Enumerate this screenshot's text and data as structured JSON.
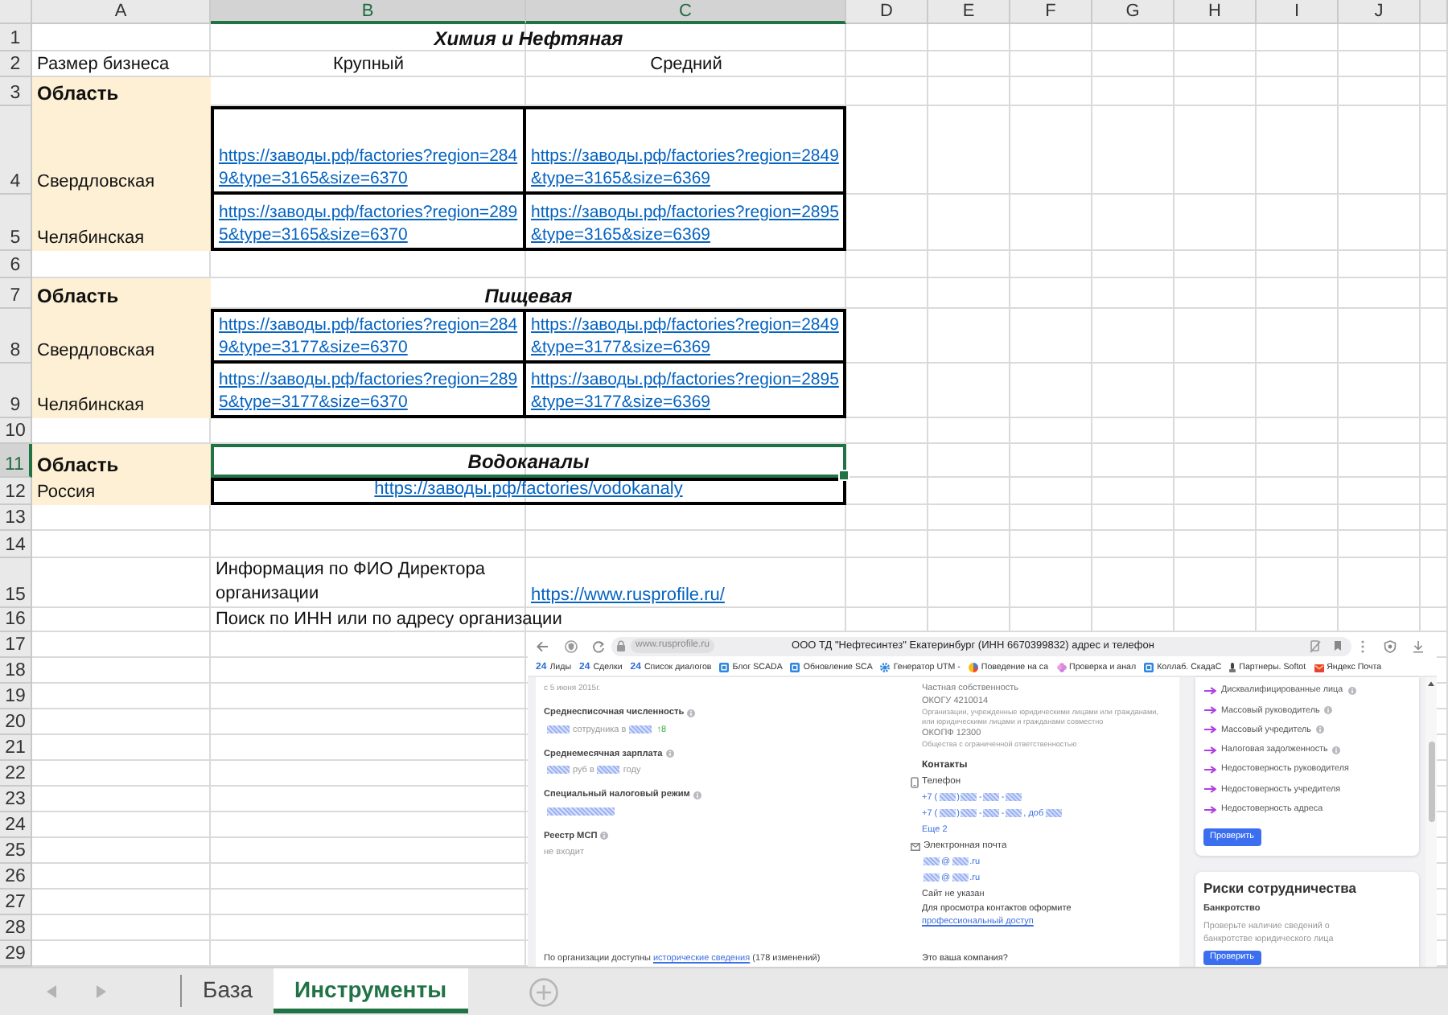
{
  "sheet": {
    "columns": [
      {
        "label": "A",
        "selected": false
      },
      {
        "label": "B",
        "selected": true
      },
      {
        "label": "C",
        "selected": true
      },
      {
        "label": "D",
        "selected": false
      },
      {
        "label": "E",
        "selected": false
      },
      {
        "label": "F",
        "selected": false
      },
      {
        "label": "G",
        "selected": false
      },
      {
        "label": "H",
        "selected": false
      },
      {
        "label": "I",
        "selected": false
      },
      {
        "label": "J",
        "selected": false
      }
    ],
    "rows": [
      {
        "number": "1",
        "kind": "title",
        "selected": false,
        "highlighted": false,
        "title": "Химия и Нефтяная"
      },
      {
        "number": "2",
        "kind": "headers",
        "selected": false,
        "highlighted": false,
        "label": "Размер бизнеса",
        "headers": [
          "Крупный",
          "Средний"
        ]
      },
      {
        "number": "3",
        "kind": "section",
        "selected": false,
        "highlighted": true,
        "label": "Область"
      },
      {
        "number": "4",
        "kind": "links",
        "selected": false,
        "highlighted": true,
        "label": "Свердловская",
        "links": [
          "https://заводы.рф/factories?region=2849&type=3165&size=6370",
          "https://заводы.рф/factories?region=2849&type=3165&size=6369"
        ]
      },
      {
        "number": "5",
        "kind": "links",
        "selected": false,
        "highlighted": true,
        "label": "Челябинская",
        "links": [
          "https://заводы.рф/factories?region=2895&type=3165&size=6370",
          "https://заводы.рф/factories?region=2895&type=3165&size=6369"
        ]
      },
      {
        "number": "6",
        "kind": "blank",
        "selected": false,
        "highlighted": false
      },
      {
        "number": "7",
        "kind": "section",
        "selected": false,
        "highlighted": true,
        "label": "Область",
        "title": "Пищевая"
      },
      {
        "number": "8",
        "kind": "links",
        "selected": false,
        "highlighted": true,
        "label": "Свердловская",
        "links": [
          "https://заводы.рф/factories?region=2849&type=3177&size=6370",
          "https://заводы.рф/factories?region=2849&type=3177&size=6369"
        ]
      },
      {
        "number": "9",
        "kind": "links",
        "selected": false,
        "highlighted": true,
        "label": "Челябинская",
        "links": [
          "https://заводы.рф/factories?region=2895&type=3177&size=6370",
          "https://заводы.рф/factories?region=2895&type=3177&size=6369"
        ]
      },
      {
        "number": "10",
        "kind": "blank",
        "selected": false,
        "highlighted": false
      },
      {
        "number": "11",
        "kind": "section",
        "selected": true,
        "highlighted": true,
        "label": "Область",
        "title": "Водоканалы"
      },
      {
        "number": "12",
        "kind": "wide_link",
        "selected": false,
        "highlighted": true,
        "label": "Россия",
        "link": "https://заводы.рф/factories/vodokanaly"
      },
      {
        "number": "13",
        "kind": "blank",
        "selected": false,
        "highlighted": false
      },
      {
        "number": "14",
        "kind": "blank",
        "selected": false,
        "highlighted": false
      },
      {
        "number": "15",
        "kind": "info",
        "selected": false,
        "highlighted": false,
        "text": "Информация по ФИО Директора организации",
        "link": "https://www.rusprofile.ru/"
      },
      {
        "number": "16",
        "kind": "info",
        "selected": false,
        "highlighted": false,
        "text": "Поиск по ИНН или по адресу организации"
      },
      {
        "number": "17",
        "kind": "blank",
        "selected": false,
        "highlighted": false
      },
      {
        "number": "18",
        "kind": "blank",
        "selected": false,
        "highlighted": false
      },
      {
        "number": "19",
        "kind": "blank",
        "selected": false,
        "highlighted": false
      },
      {
        "number": "20",
        "kind": "blank",
        "selected": false,
        "highlighted": false
      },
      {
        "number": "21",
        "kind": "blank",
        "selected": false,
        "highlighted": false
      },
      {
        "number": "22",
        "kind": "blank",
        "selected": false,
        "highlighted": false
      },
      {
        "number": "23",
        "kind": "blank",
        "selected": false,
        "highlighted": false
      },
      {
        "number": "24",
        "kind": "blank",
        "selected": false,
        "highlighted": false
      },
      {
        "number": "25",
        "kind": "blank",
        "selected": false,
        "highlighted": false
      },
      {
        "number": "26",
        "kind": "blank",
        "selected": false,
        "highlighted": false
      },
      {
        "number": "27",
        "kind": "blank",
        "selected": false,
        "highlighted": false
      },
      {
        "number": "28",
        "kind": "blank",
        "selected": false,
        "highlighted": false
      },
      {
        "number": "29",
        "kind": "blank",
        "selected": false,
        "highlighted": false
      }
    ]
  },
  "picture": {
    "address_bar": {
      "url": "www.rusprofile.ru",
      "title": "ООО ТД \"Нефтесинтез\" Екатеринбург (ИНН 6670399832) адрес и телефон"
    },
    "bookmarks": [
      {
        "kind": "logo",
        "logo": "24",
        "label": "Лиды"
      },
      {
        "kind": "logo",
        "logo": "24",
        "label": "Сделки"
      },
      {
        "kind": "logo",
        "logo": "24",
        "label": "Список диалогов"
      },
      {
        "kind": "tile",
        "label": "Блог SCADA"
      },
      {
        "kind": "tile",
        "label": "Обновление SCA"
      },
      {
        "kind": "gear",
        "label": "Генератор UTM -"
      },
      {
        "kind": "pie",
        "label": "Поведение на са"
      },
      {
        "kind": "flower",
        "label": "Проверка и анал"
      },
      {
        "kind": "tile",
        "label": "Коллаб. СкадаС"
      },
      {
        "kind": "pin",
        "label": "Партнеры. Softot"
      },
      {
        "kind": "envelope",
        "label": "Яндекс Почта"
      }
    ],
    "overview": [
      {
        "kind": "note",
        "text": "с 5 июня 2015г."
      },
      {
        "kind": "heading",
        "text": "Среднесписочная численность",
        "info": true
      },
      {
        "kind": "value",
        "parts": [
          {
            "kind": "redaction"
          },
          {
            "kind": "text",
            "text": "сотрудника в"
          },
          {
            "kind": "redaction"
          },
          {
            "kind": "accent",
            "text": "↑8"
          }
        ]
      },
      {
        "kind": "heading",
        "text": "Среднемесячная зарплата",
        "info": true
      },
      {
        "kind": "value",
        "parts": [
          {
            "kind": "redaction"
          },
          {
            "kind": "text",
            "text": "руб в"
          },
          {
            "kind": "redaction"
          },
          {
            "kind": "text",
            "text": "году"
          }
        ]
      },
      {
        "kind": "heading",
        "text": "Специальный налоговый режим",
        "info": true
      },
      {
        "kind": "value",
        "parts": [
          {
            "kind": "redaction"
          }
        ]
      },
      {
        "kind": "heading",
        "text": "Реестр МСП",
        "info": true
      },
      {
        "kind": "value",
        "parts": [
          {
            "kind": "text",
            "text": "не входит"
          }
        ]
      }
    ],
    "history": {
      "text": "По организации доступны",
      "link": "исторические сведения",
      "after": "(178 изменений)"
    },
    "registry": [
      {
        "kind": "code",
        "text": "Частная собственность"
      },
      {
        "kind": "code",
        "text": "ОКОГУ  4210014"
      },
      {
        "kind": "small",
        "text": "Организации, учрежденные юридическими лицами или гражданами, или юридическими лицами и гражданами совместно"
      },
      {
        "kind": "code",
        "text": "ОКОПФ  12300"
      },
      {
        "kind": "small",
        "text": "Общества с ограниченной ответственностью"
      }
    ],
    "contacts": {
      "title": "Контакты",
      "groups": [
        {
          "kind": "phone",
          "label": "Телефон",
          "lines": [
            {
              "parts": [
                {
                  "kind": "text",
                  "text": "+7 ("
                },
                {
                  "kind": "redaction"
                },
                {
                  "kind": "text",
                  "text": ")"
                },
                {
                  "kind": "redaction"
                },
                {
                  "kind": "text",
                  "text": "-"
                },
                {
                  "kind": "redaction"
                },
                {
                  "kind": "text",
                  "text": "-"
                },
                {
                  "kind": "redaction"
                }
              ]
            },
            {
              "parts": [
                {
                  "kind": "text",
                  "text": "+7 ("
                },
                {
                  "kind": "redaction"
                },
                {
                  "kind": "text",
                  "text": ")"
                },
                {
                  "kind": "redaction"
                },
                {
                  "kind": "text",
                  "text": "-"
                },
                {
                  "kind": "redaction"
                },
                {
                  "kind": "text",
                  "text": "-"
                },
                {
                  "kind": "redaction"
                },
                {
                  "kind": "text",
                  "text": ", доб"
                },
                {
                  "kind": "redaction"
                }
              ]
            }
          ],
          "more": "Еще 2"
        },
        {
          "kind": "email",
          "label": "Электронная почта",
          "lines": [
            {
              "parts": [
                {
                  "kind": "redaction"
                },
                {
                  "kind": "text",
                  "text": "@"
                },
                {
                  "kind": "redaction"
                },
                {
                  "kind": "text",
                  "text": ".ru"
                }
              ]
            },
            {
              "parts": [
                {
                  "kind": "redaction"
                },
                {
                  "kind": "text",
                  "text": "@"
                },
                {
                  "kind": "redaction"
                },
                {
                  "kind": "text",
                  "text": ".ru"
                }
              ]
            }
          ]
        }
      ],
      "site": "Сайт не указан",
      "access": {
        "text": "Для просмотра контактов оформите",
        "link": "профессиональный доступ"
      },
      "question": "Это ваша компания?"
    },
    "checks": {
      "items": [
        {
          "text": "Дисквалифицированные лица",
          "info": true
        },
        {
          "text": "Массовый руководитель",
          "info": true
        },
        {
          "text": "Массовый учредитель",
          "info": true
        },
        {
          "text": "Налоговая задолженность",
          "info": true
        },
        {
          "text": "Недостоверность руководителя",
          "info": false
        },
        {
          "text": "Недостоверность учредителя",
          "info": false
        },
        {
          "text": "Недостоверность адреса",
          "info": false
        }
      ],
      "button": "Проверить"
    },
    "risks": {
      "title": "Риски сотрудничества",
      "subtitle": "Банкротство",
      "text": "Проверьте наличие сведений о банкротстве юридического лица",
      "button": "Проверить"
    }
  },
  "sheet_tabs": [
    {
      "label": "База",
      "selected": false
    },
    {
      "label": "Инструменты",
      "selected": true
    }
  ]
}
